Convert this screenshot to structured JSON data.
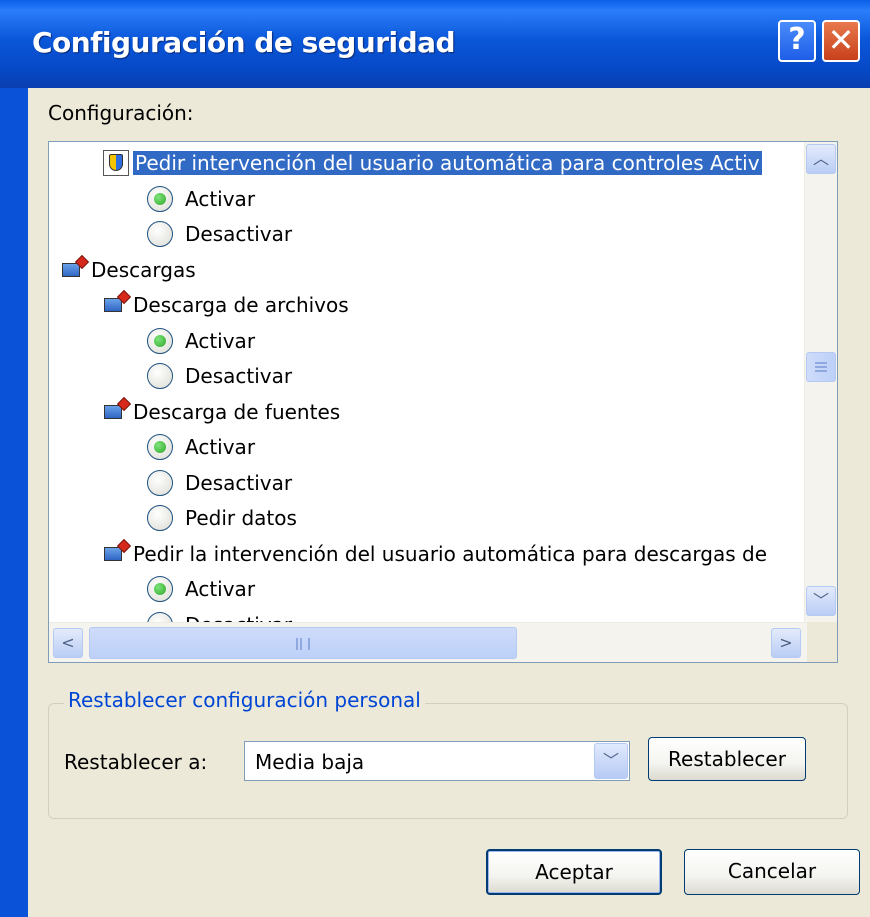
{
  "window": {
    "title": "Configuración de seguridad",
    "help_glyph": "?",
    "close_glyph": "✕"
  },
  "settings": {
    "label": "Configuración:",
    "items": [
      {
        "kind": "setting",
        "label": "Pedir intervención del usuario automática para controles Activ",
        "icon": "shield-icon",
        "selected": true
      },
      {
        "kind": "option",
        "label": "Activar",
        "checked": true
      },
      {
        "kind": "option",
        "label": "Desactivar",
        "checked": false
      },
      {
        "kind": "category",
        "label": "Descargas",
        "icon": "download-icon"
      },
      {
        "kind": "setting",
        "label": "Descarga de archivos",
        "icon": "download-icon"
      },
      {
        "kind": "option",
        "label": "Activar",
        "checked": true
      },
      {
        "kind": "option",
        "label": "Desactivar",
        "checked": false
      },
      {
        "kind": "setting",
        "label": "Descarga de fuentes",
        "icon": "download-icon"
      },
      {
        "kind": "option",
        "label": "Activar",
        "checked": true
      },
      {
        "kind": "option",
        "label": "Desactivar",
        "checked": false
      },
      {
        "kind": "option",
        "label": "Pedir datos",
        "checked": false
      },
      {
        "kind": "setting",
        "label": "Pedir la intervención del usuario automática para descargas de",
        "icon": "download-icon"
      },
      {
        "kind": "option",
        "label": "Activar",
        "checked": true
      },
      {
        "kind": "option",
        "label": "Desactivar",
        "checked": false
      }
    ]
  },
  "reset_group": {
    "legend": "Restablecer configuración personal",
    "label": "Restablecer a:",
    "level_value": "Media baja",
    "reset_button": "Restablecer"
  },
  "footer": {
    "ok_button": "Aceptar",
    "cancel_button": "Cancelar"
  },
  "colors": {
    "titlebar": "#0a57d9",
    "selection": "#316ac5",
    "group_legend": "#0046d5"
  }
}
